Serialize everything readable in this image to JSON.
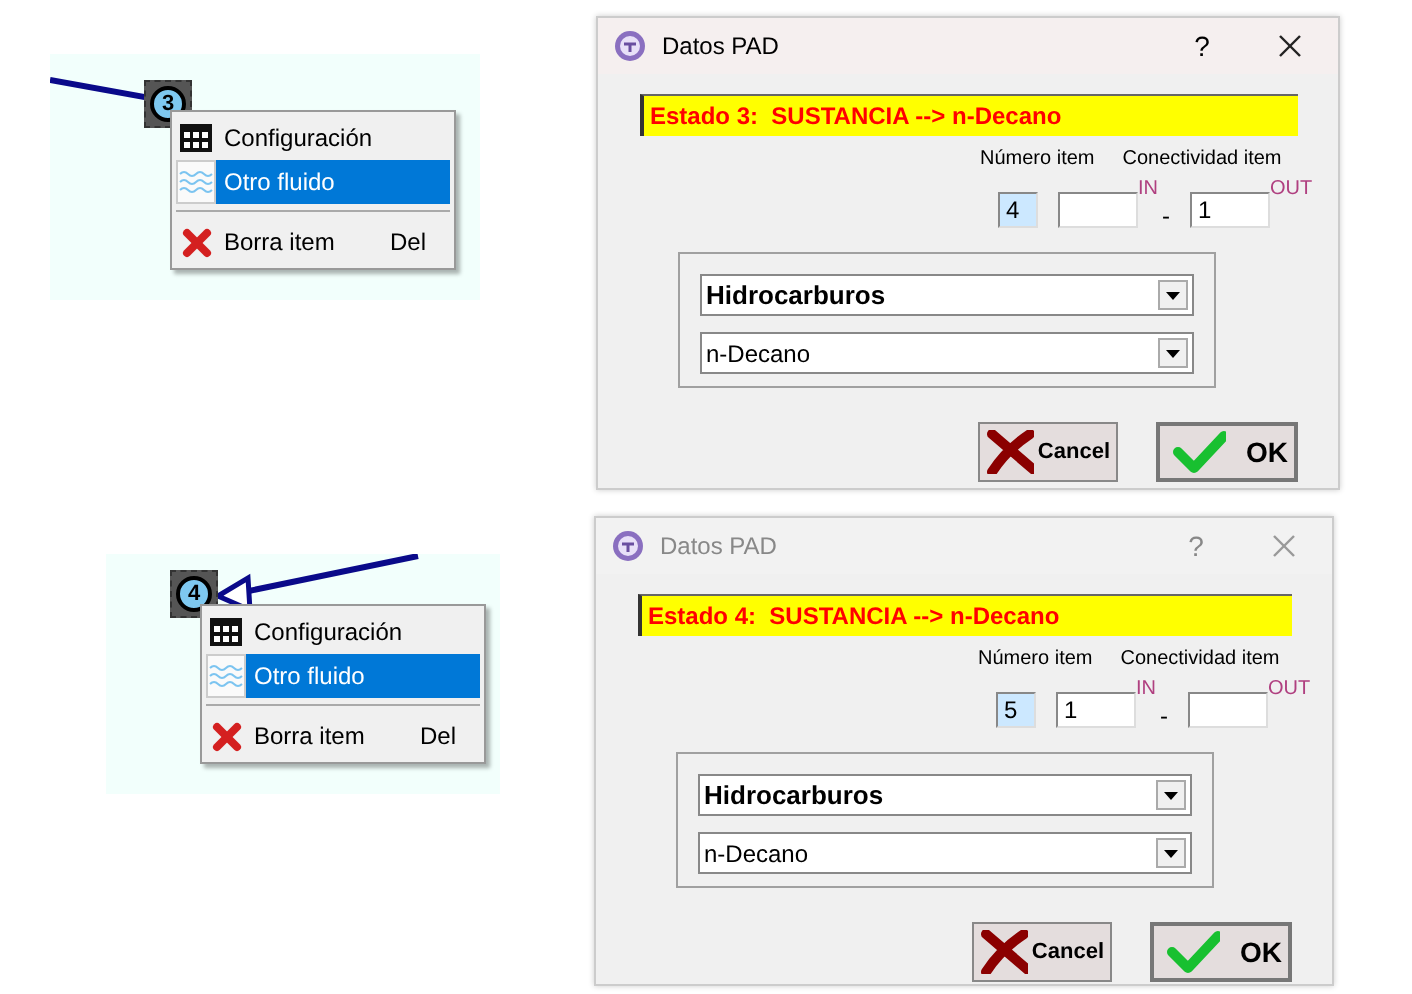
{
  "panels": [
    {
      "canvas": {
        "node_label": "3",
        "arrow": false,
        "menu": [
          {
            "label": "Configuración",
            "selected": false
          },
          {
            "label": "Otro fluido",
            "selected": true
          },
          {
            "label": "Borra item",
            "shortcut": "Del",
            "selected": false
          }
        ]
      },
      "dialog": {
        "title": "Datos PAD",
        "active": true,
        "help": "?",
        "status": "Estado 3:  SUSTANCIA --> n-Decano",
        "number_label": "Número item",
        "connectivity_label": "Conectividad item",
        "number_value": "4",
        "in_label": "IN",
        "dash": "-",
        "out_value": "1",
        "out_label": "OUT",
        "category": "Hidrocarburos",
        "substance": "n-Decano",
        "cancel": "Cancel",
        "ok": "OK"
      }
    },
    {
      "canvas": {
        "node_label": "4",
        "arrow": true,
        "menu": [
          {
            "label": "Configuración",
            "selected": false
          },
          {
            "label": "Otro fluido",
            "selected": true
          },
          {
            "label": "Borra item",
            "shortcut": "Del",
            "selected": false
          }
        ]
      },
      "dialog": {
        "title": "Datos PAD",
        "active": false,
        "help": "?",
        "status": "Estado 4:  SUSTANCIA --> n-Decano",
        "number_label": "Número item",
        "connectivity_label": "Conectividad item",
        "number_value": "5",
        "in_value": "1",
        "in_label": "IN",
        "dash": "-",
        "out_label": "OUT",
        "category": "Hidrocarburos",
        "substance": "n-Decano",
        "cancel": "Cancel",
        "ok": "OK"
      }
    }
  ]
}
